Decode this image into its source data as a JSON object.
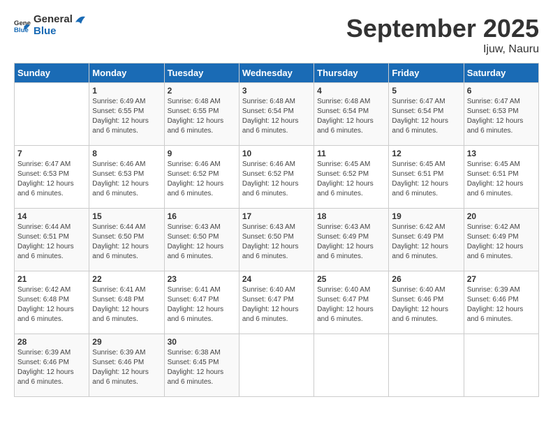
{
  "header": {
    "logo_general": "General",
    "logo_blue": "Blue",
    "month": "September 2025",
    "location": "Ijuw, Nauru"
  },
  "weekdays": [
    "Sunday",
    "Monday",
    "Tuesday",
    "Wednesday",
    "Thursday",
    "Friday",
    "Saturday"
  ],
  "weeks": [
    [
      {
        "day": "",
        "info": ""
      },
      {
        "day": "1",
        "info": "Sunrise: 6:49 AM\nSunset: 6:55 PM\nDaylight: 12 hours\nand 6 minutes."
      },
      {
        "day": "2",
        "info": "Sunrise: 6:48 AM\nSunset: 6:55 PM\nDaylight: 12 hours\nand 6 minutes."
      },
      {
        "day": "3",
        "info": "Sunrise: 6:48 AM\nSunset: 6:54 PM\nDaylight: 12 hours\nand 6 minutes."
      },
      {
        "day": "4",
        "info": "Sunrise: 6:48 AM\nSunset: 6:54 PM\nDaylight: 12 hours\nand 6 minutes."
      },
      {
        "day": "5",
        "info": "Sunrise: 6:47 AM\nSunset: 6:54 PM\nDaylight: 12 hours\nand 6 minutes."
      },
      {
        "day": "6",
        "info": "Sunrise: 6:47 AM\nSunset: 6:53 PM\nDaylight: 12 hours\nand 6 minutes."
      }
    ],
    [
      {
        "day": "7",
        "info": "Sunrise: 6:47 AM\nSunset: 6:53 PM\nDaylight: 12 hours\nand 6 minutes."
      },
      {
        "day": "8",
        "info": "Sunrise: 6:46 AM\nSunset: 6:53 PM\nDaylight: 12 hours\nand 6 minutes."
      },
      {
        "day": "9",
        "info": "Sunrise: 6:46 AM\nSunset: 6:52 PM\nDaylight: 12 hours\nand 6 minutes."
      },
      {
        "day": "10",
        "info": "Sunrise: 6:46 AM\nSunset: 6:52 PM\nDaylight: 12 hours\nand 6 minutes."
      },
      {
        "day": "11",
        "info": "Sunrise: 6:45 AM\nSunset: 6:52 PM\nDaylight: 12 hours\nand 6 minutes."
      },
      {
        "day": "12",
        "info": "Sunrise: 6:45 AM\nSunset: 6:51 PM\nDaylight: 12 hours\nand 6 minutes."
      },
      {
        "day": "13",
        "info": "Sunrise: 6:45 AM\nSunset: 6:51 PM\nDaylight: 12 hours\nand 6 minutes."
      }
    ],
    [
      {
        "day": "14",
        "info": "Sunrise: 6:44 AM\nSunset: 6:51 PM\nDaylight: 12 hours\nand 6 minutes."
      },
      {
        "day": "15",
        "info": "Sunrise: 6:44 AM\nSunset: 6:50 PM\nDaylight: 12 hours\nand 6 minutes."
      },
      {
        "day": "16",
        "info": "Sunrise: 6:43 AM\nSunset: 6:50 PM\nDaylight: 12 hours\nand 6 minutes."
      },
      {
        "day": "17",
        "info": "Sunrise: 6:43 AM\nSunset: 6:50 PM\nDaylight: 12 hours\nand 6 minutes."
      },
      {
        "day": "18",
        "info": "Sunrise: 6:43 AM\nSunset: 6:49 PM\nDaylight: 12 hours\nand 6 minutes."
      },
      {
        "day": "19",
        "info": "Sunrise: 6:42 AM\nSunset: 6:49 PM\nDaylight: 12 hours\nand 6 minutes."
      },
      {
        "day": "20",
        "info": "Sunrise: 6:42 AM\nSunset: 6:49 PM\nDaylight: 12 hours\nand 6 minutes."
      }
    ],
    [
      {
        "day": "21",
        "info": "Sunrise: 6:42 AM\nSunset: 6:48 PM\nDaylight: 12 hours\nand 6 minutes."
      },
      {
        "day": "22",
        "info": "Sunrise: 6:41 AM\nSunset: 6:48 PM\nDaylight: 12 hours\nand 6 minutes."
      },
      {
        "day": "23",
        "info": "Sunrise: 6:41 AM\nSunset: 6:47 PM\nDaylight: 12 hours\nand 6 minutes."
      },
      {
        "day": "24",
        "info": "Sunrise: 6:40 AM\nSunset: 6:47 PM\nDaylight: 12 hours\nand 6 minutes."
      },
      {
        "day": "25",
        "info": "Sunrise: 6:40 AM\nSunset: 6:47 PM\nDaylight: 12 hours\nand 6 minutes."
      },
      {
        "day": "26",
        "info": "Sunrise: 6:40 AM\nSunset: 6:46 PM\nDaylight: 12 hours\nand 6 minutes."
      },
      {
        "day": "27",
        "info": "Sunrise: 6:39 AM\nSunset: 6:46 PM\nDaylight: 12 hours\nand 6 minutes."
      }
    ],
    [
      {
        "day": "28",
        "info": "Sunrise: 6:39 AM\nSunset: 6:46 PM\nDaylight: 12 hours\nand 6 minutes."
      },
      {
        "day": "29",
        "info": "Sunrise: 6:39 AM\nSunset: 6:46 PM\nDaylight: 12 hours\nand 6 minutes."
      },
      {
        "day": "30",
        "info": "Sunrise: 6:38 AM\nSunset: 6:45 PM\nDaylight: 12 hours\nand 6 minutes."
      },
      {
        "day": "",
        "info": ""
      },
      {
        "day": "",
        "info": ""
      },
      {
        "day": "",
        "info": ""
      },
      {
        "day": "",
        "info": ""
      }
    ]
  ]
}
